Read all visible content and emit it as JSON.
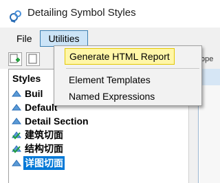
{
  "window": {
    "title": "Detailing Symbol Styles"
  },
  "menubar": {
    "file_label": "File",
    "utilities_label": "Utilities"
  },
  "utilities_menu": {
    "items": [
      {
        "label": "Generate HTML Report",
        "highlighted": true
      },
      {
        "label": "Element Templates",
        "highlighted": false
      },
      {
        "label": "Named Expressions",
        "highlighted": false
      }
    ]
  },
  "toolbar": {
    "add_icon": "add-style-icon",
    "properties_partial_label": "ope"
  },
  "styles_panel": {
    "header": "Styles",
    "items": [
      {
        "label": "Buil",
        "icon": "style-node-icon",
        "selected": false
      },
      {
        "label": "Default",
        "icon": "style-node-icon",
        "selected": false
      },
      {
        "label": "Detail Section",
        "icon": "style-node-icon",
        "selected": false
      },
      {
        "label": "建筑切面",
        "icon": "style-check-icon",
        "selected": false
      },
      {
        "label": "结构切面",
        "icon": "style-check-icon",
        "selected": false
      },
      {
        "label": "详图切面",
        "icon": "style-node-icon",
        "selected": true
      }
    ]
  },
  "colors": {
    "selection": "#0078d7",
    "menu_highlight": "#fff6a8",
    "menu_active": "#cce4f7"
  }
}
